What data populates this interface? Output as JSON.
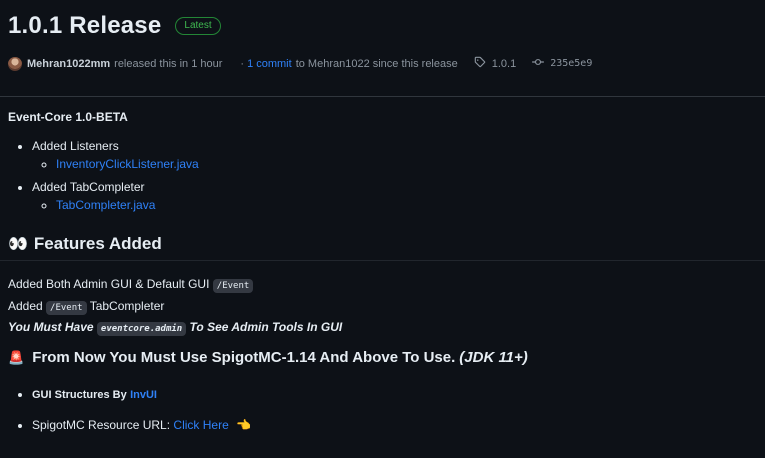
{
  "release": {
    "title": "1.0.1 Release",
    "badge": "Latest"
  },
  "meta": {
    "author": "Mehran1022mm",
    "released_text": "released this in 1 hour",
    "commits_link": "1 commit",
    "commits_suffix": "to Mehran1022 since this release",
    "tag": "1.0.1",
    "commit_hash": "235e5e9"
  },
  "body": {
    "heading": "Event-Core 1.0-BETA",
    "list": [
      {
        "label": "Added Listeners",
        "sub": "InventoryClickListener.java"
      },
      {
        "label": "Added TabCompleter",
        "sub": "TabCompleter.java"
      }
    ],
    "features_heading": "Features Added",
    "line1_text": "Added Both Admin GUI & Default GUI",
    "line1_code": "/Event",
    "line2_prefix": "Added",
    "line2_code": "/Event",
    "line2_suffix": "TabCompleter",
    "line3_prefix": "You Must Have",
    "line3_code": "eventcore.admin",
    "line3_suffix": "To See Admin Tools In GUI",
    "notice_heading": "From Now You Must Use SpigotMC-1.14 And Above To Use.",
    "notice_italic": "(JDK 11+)",
    "bullet1_text": "GUI Structures By",
    "bullet1_link": "InvUI",
    "bullet2_text": "SpigotMC Resource URL:",
    "bullet2_link": "Click Here"
  },
  "colors": {
    "background": "#0d1117",
    "link": "#2f81f7",
    "badge": "#3fb950"
  },
  "icons": [
    "avatar",
    "tag-icon",
    "commit-icon",
    "eyes-icon",
    "siren-icon",
    "pointing-hand-icon"
  ]
}
